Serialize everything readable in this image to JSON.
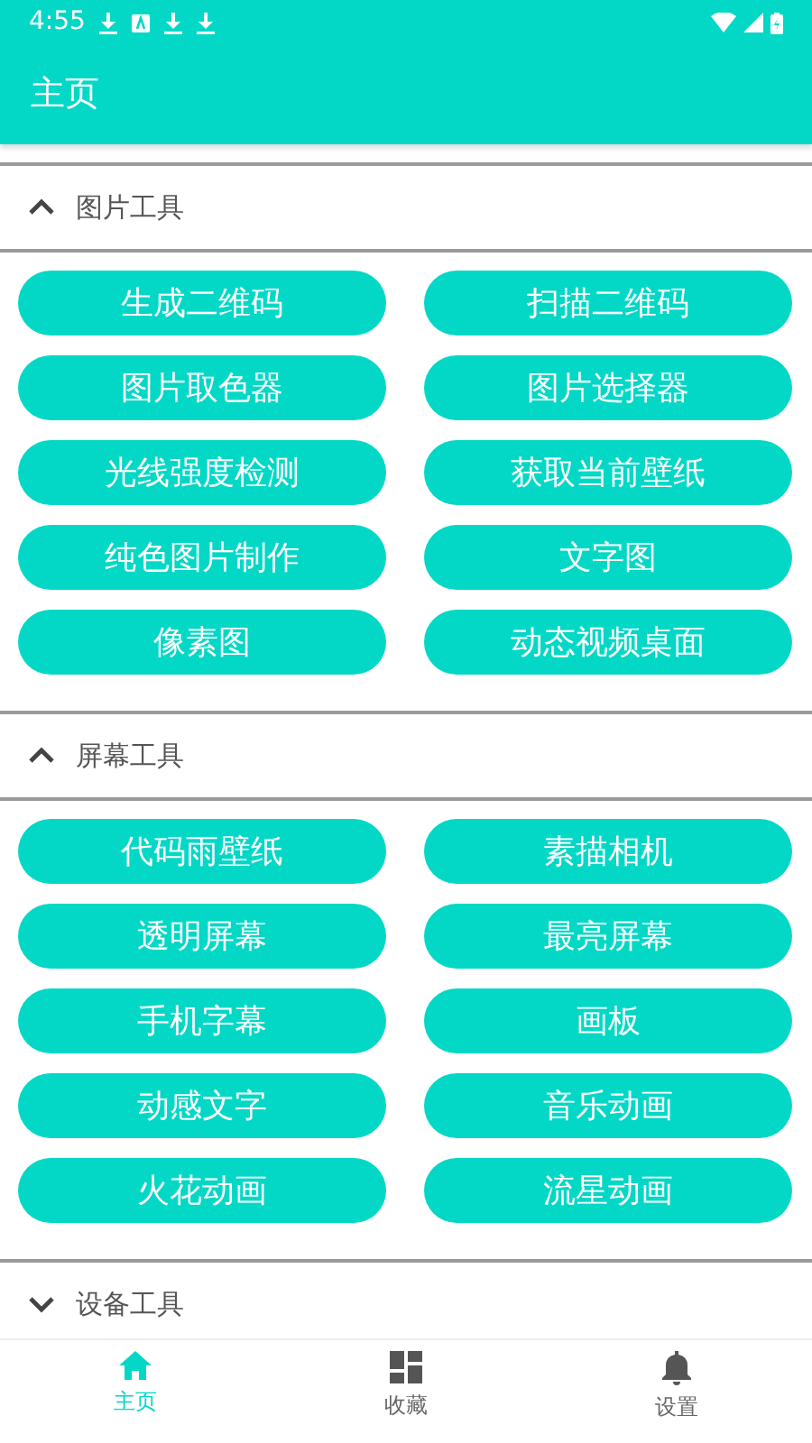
{
  "status_bar": {
    "time": "4:55"
  },
  "app_bar": {
    "title": "主页"
  },
  "sections": [
    {
      "title": "图片工具",
      "expanded": true,
      "buttons": [
        "生成二维码",
        "扫描二维码",
        "图片取色器",
        "图片选择器",
        "光线强度检测",
        "获取当前壁纸",
        "纯色图片制作",
        "文字图",
        "像素图",
        "动态视频桌面"
      ]
    },
    {
      "title": "屏幕工具",
      "expanded": true,
      "buttons": [
        "代码雨壁纸",
        "素描相机",
        "透明屏幕",
        "最亮屏幕",
        "手机字幕",
        "画板",
        "动感文字",
        "音乐动画",
        "火花动画",
        "流星动画"
      ]
    },
    {
      "title": "设备工具",
      "expanded": false
    }
  ],
  "bottom_nav": [
    {
      "label": "主页",
      "selected": true
    },
    {
      "label": "收藏",
      "selected": false
    },
    {
      "label": "设置",
      "selected": false
    }
  ]
}
